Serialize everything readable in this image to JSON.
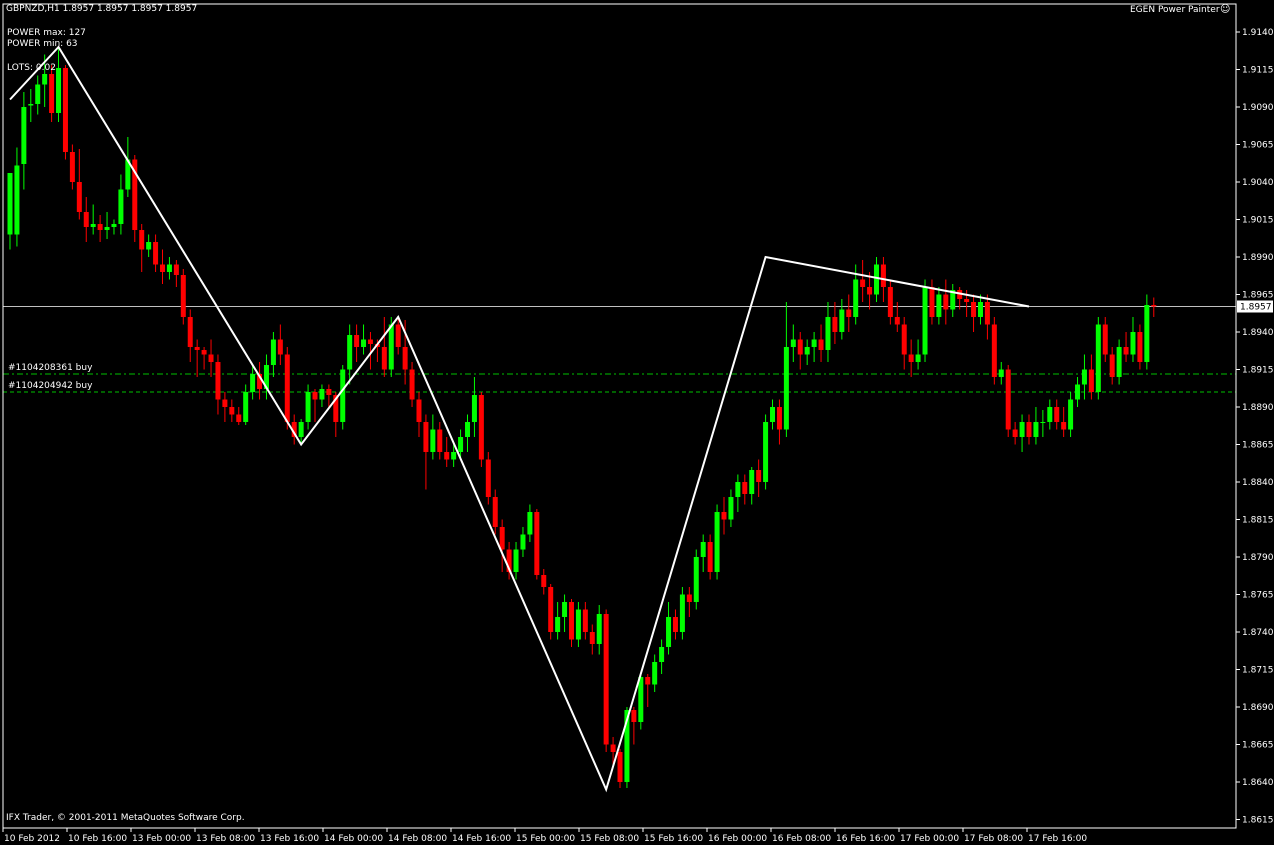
{
  "header": {
    "title": "GBPNZD,H1  1.8957 1.8957 1.8957 1.8957",
    "indicator_name": "EGEN Power Painter",
    "indicator_icon": "smiley-face-icon"
  },
  "info": {
    "power_max": "POWER max: 127",
    "power_min": "POWER min: 63",
    "lots": "LOTS: 0.02"
  },
  "orders": [
    {
      "label": "#1104208361 buy",
      "price": 1.8912
    },
    {
      "label": "#1104204942 buy",
      "price": 1.89
    }
  ],
  "footer": {
    "copyright": "IFX Trader, © 2001-2011 MetaQuotes Software Corp."
  },
  "colors": {
    "background": "#000000",
    "bull": "#00FF00",
    "bear": "#FF0000",
    "frame": "#FFFFFF",
    "order_line": "#00C000",
    "zigzag": "#FFFFFF"
  },
  "chart_data": {
    "type": "candlestick",
    "symbol": "GBPNZD",
    "timeframe": "H1",
    "current_price": 1.8957,
    "current_price_label": "1.8957",
    "y_ticks": [
      "1.9140",
      "1.9115",
      "1.9090",
      "1.9065",
      "1.9040",
      "1.9015",
      "1.8990",
      "1.8965",
      "1.8940",
      "1.8915",
      "1.8890",
      "1.8865",
      "1.8840",
      "1.8815",
      "1.8790",
      "1.8765",
      "1.8740",
      "1.8715",
      "1.8690",
      "1.8665",
      "1.8640",
      "1.8615"
    ],
    "ylim": [
      1.861,
      1.916
    ],
    "x_ticks": [
      "10 Feb 2012",
      "10 Feb 16:00",
      "13 Feb 00:00",
      "13 Feb 08:00",
      "13 Feb 16:00",
      "14 Feb 00:00",
      "14 Feb 08:00",
      "14 Feb 16:00",
      "15 Feb 00:00",
      "15 Feb 08:00",
      "15 Feb 16:00",
      "16 Feb 00:00",
      "16 Feb 08:00",
      "16 Feb 16:00",
      "17 Feb 00:00",
      "17 Feb 08:00",
      "17 Feb 16:00"
    ],
    "zigzag": [
      [
        0,
        1.9095
      ],
      [
        7,
        1.913
      ],
      [
        42,
        1.8865
      ],
      [
        56,
        1.895
      ],
      [
        86,
        1.8635
      ],
      [
        109,
        1.899
      ],
      [
        147,
        1.8957
      ]
    ],
    "candles": [
      [
        1.9005,
        1.9046,
        1.901,
        1.8995
      ],
      [
        1.9005,
        1.9051,
        1.8997,
        1.9063
      ],
      [
        1.9052,
        1.909,
        1.9035,
        1.91
      ],
      [
        1.9091,
        1.9092,
        1.908,
        1.9102
      ],
      [
        1.9092,
        1.9105,
        1.9085,
        1.9111
      ],
      [
        1.9105,
        1.9112,
        1.909,
        1.9125
      ],
      [
        1.9112,
        1.9086,
        1.908,
        1.9118
      ],
      [
        1.9086,
        1.9116,
        1.908,
        1.913
      ],
      [
        1.9116,
        1.906,
        1.9055,
        1.9118
      ],
      [
        1.906,
        1.904,
        1.9035,
        1.9065
      ],
      [
        1.904,
        1.902,
        1.9015,
        1.9062
      ],
      [
        1.902,
        1.901,
        1.9,
        1.903
      ],
      [
        1.901,
        1.9012,
        1.9005,
        1.9025
      ],
      [
        1.9012,
        1.9008,
        1.9,
        1.9018
      ],
      [
        1.9008,
        1.901,
        1.9002,
        1.902
      ],
      [
        1.901,
        1.9012,
        1.9005,
        1.9015
      ],
      [
        1.9012,
        1.9035,
        1.9005,
        1.9045
      ],
      [
        1.9035,
        1.9055,
        1.903,
        1.907
      ],
      [
        1.9055,
        1.9008,
        1.9,
        1.9058
      ],
      [
        1.9008,
        1.8995,
        1.898,
        1.9012
      ],
      [
        1.8995,
        1.9,
        1.899,
        1.9005
      ],
      [
        1.9,
        1.8985,
        1.898,
        1.9005
      ],
      [
        1.8985,
        1.898,
        1.8972,
        1.8995
      ],
      [
        1.898,
        1.8985,
        1.8975,
        1.899
      ],
      [
        1.8985,
        1.8978,
        1.897,
        1.8988
      ],
      [
        1.8978,
        1.895,
        1.8945,
        1.8982
      ],
      [
        1.895,
        1.893,
        1.892,
        1.8955
      ],
      [
        1.893,
        1.8928,
        1.891,
        1.8935
      ],
      [
        1.8928,
        1.8925,
        1.8915,
        1.893
      ],
      [
        1.8925,
        1.892,
        1.891,
        1.8935
      ],
      [
        1.892,
        1.8895,
        1.8885,
        1.8925
      ],
      [
        1.8895,
        1.889,
        1.888,
        1.89
      ],
      [
        1.889,
        1.8885,
        1.888,
        1.8895
      ],
      [
        1.8885,
        1.888,
        1.8878,
        1.889
      ],
      [
        1.888,
        1.89,
        1.8878,
        1.8905
      ],
      [
        1.89,
        1.8912,
        1.8895,
        1.8918
      ],
      [
        1.8912,
        1.8902,
        1.8895,
        1.892
      ],
      [
        1.8902,
        1.8918,
        1.8895,
        1.8925
      ],
      [
        1.8918,
        1.8935,
        1.891,
        1.894
      ],
      [
        1.8935,
        1.8925,
        1.8918,
        1.8945
      ],
      [
        1.8925,
        1.888,
        1.8875,
        1.893
      ],
      [
        1.888,
        1.887,
        1.8865,
        1.8885
      ],
      [
        1.887,
        1.888,
        1.8865,
        1.8882
      ],
      [
        1.888,
        1.89,
        1.8875,
        1.8905
      ],
      [
        1.89,
        1.8895,
        1.888,
        1.8902
      ],
      [
        1.8895,
        1.8902,
        1.889,
        1.8905
      ],
      [
        1.8902,
        1.8898,
        1.889,
        1.8905
      ],
      [
        1.8898,
        1.888,
        1.887,
        1.89
      ],
      [
        1.888,
        1.8915,
        1.8875,
        1.8918
      ],
      [
        1.8915,
        1.8938,
        1.8905,
        1.8945
      ],
      [
        1.8938,
        1.893,
        1.892,
        1.8945
      ],
      [
        1.893,
        1.8935,
        1.8925,
        1.8945
      ],
      [
        1.8935,
        1.8932,
        1.8915,
        1.894
      ],
      [
        1.8932,
        1.893,
        1.892,
        1.8935
      ],
      [
        1.893,
        1.8915,
        1.891,
        1.895
      ],
      [
        1.8915,
        1.8945,
        1.891,
        1.895
      ],
      [
        1.8945,
        1.893,
        1.8925,
        1.895
      ],
      [
        1.893,
        1.8915,
        1.8905,
        1.8948
      ],
      [
        1.8915,
        1.8895,
        1.889,
        1.892
      ],
      [
        1.8895,
        1.888,
        1.887,
        1.89
      ],
      [
        1.888,
        1.886,
        1.8835,
        1.8885
      ],
      [
        1.886,
        1.8875,
        1.8855,
        1.8885
      ],
      [
        1.8875,
        1.886,
        1.8855,
        1.888
      ],
      [
        1.886,
        1.8855,
        1.885,
        1.887
      ],
      [
        1.8855,
        1.886,
        1.885,
        1.8865
      ],
      [
        1.886,
        1.887,
        1.8855,
        1.8875
      ],
      [
        1.887,
        1.888,
        1.886,
        1.8885
      ],
      [
        1.888,
        1.8898,
        1.887,
        1.891
      ],
      [
        1.8898,
        1.8855,
        1.885,
        1.89
      ],
      [
        1.8855,
        1.883,
        1.8825,
        1.886
      ],
      [
        1.883,
        1.881,
        1.8805,
        1.8835
      ],
      [
        1.881,
        1.8795,
        1.878,
        1.8815
      ],
      [
        1.8795,
        1.878,
        1.8775,
        1.88
      ],
      [
        1.878,
        1.8795,
        1.8775,
        1.88
      ],
      [
        1.8795,
        1.8805,
        1.879,
        1.881
      ],
      [
        1.8805,
        1.882,
        1.88,
        1.8825
      ],
      [
        1.882,
        1.8778,
        1.8775,
        1.8822
      ],
      [
        1.8778,
        1.877,
        1.8765,
        1.8782
      ],
      [
        1.877,
        1.874,
        1.8735,
        1.8772
      ],
      [
        1.874,
        1.875,
        1.8735,
        1.876
      ],
      [
        1.875,
        1.876,
        1.874,
        1.8765
      ],
      [
        1.876,
        1.8735,
        1.873,
        1.8762
      ],
      [
        1.8735,
        1.8755,
        1.873,
        1.876
      ],
      [
        1.8755,
        1.874,
        1.8735,
        1.876
      ],
      [
        1.874,
        1.8732,
        1.8725,
        1.8745
      ],
      [
        1.8732,
        1.8752,
        1.8725,
        1.8758
      ],
      [
        1.8752,
        1.8665,
        1.866,
        1.8755
      ],
      [
        1.8665,
        1.866,
        1.865,
        1.867
      ],
      [
        1.866,
        1.864,
        1.8636,
        1.8662
      ],
      [
        1.864,
        1.8688,
        1.8636,
        1.869
      ],
      [
        1.8688,
        1.868,
        1.8665,
        1.869
      ],
      [
        1.868,
        1.871,
        1.8675,
        1.8712
      ],
      [
        1.871,
        1.8705,
        1.869,
        1.8712
      ],
      [
        1.8705,
        1.872,
        1.87,
        1.8725
      ],
      [
        1.872,
        1.873,
        1.8712,
        1.8735
      ],
      [
        1.873,
        1.875,
        1.8725,
        1.876
      ],
      [
        1.875,
        1.874,
        1.8735,
        1.8755
      ],
      [
        1.874,
        1.8765,
        1.8735,
        1.877
      ],
      [
        1.8765,
        1.876,
        1.875,
        1.877
      ],
      [
        1.876,
        1.879,
        1.8755,
        1.8795
      ],
      [
        1.879,
        1.88,
        1.878,
        1.8805
      ],
      [
        1.88,
        1.878,
        1.8775,
        1.8805
      ],
      [
        1.878,
        1.882,
        1.8775,
        1.8825
      ],
      [
        1.882,
        1.8815,
        1.8805,
        1.883
      ],
      [
        1.8815,
        1.883,
        1.881,
        1.8835
      ],
      [
        1.883,
        1.884,
        1.882,
        1.8845
      ],
      [
        1.884,
        1.8832,
        1.8825,
        1.8845
      ],
      [
        1.8832,
        1.8848,
        1.8825,
        1.885
      ],
      [
        1.8848,
        1.884,
        1.883,
        1.8855
      ],
      [
        1.884,
        1.888,
        1.8835,
        1.8885
      ],
      [
        1.888,
        1.889,
        1.8875,
        1.8895
      ],
      [
        1.889,
        1.8875,
        1.8865,
        1.8895
      ],
      [
        1.8875,
        1.893,
        1.887,
        1.896
      ],
      [
        1.893,
        1.8935,
        1.892,
        1.8945
      ],
      [
        1.8935,
        1.8925,
        1.8915,
        1.894
      ],
      [
        1.8925,
        1.893,
        1.8918,
        1.8935
      ],
      [
        1.893,
        1.8935,
        1.892,
        1.894
      ],
      [
        1.8935,
        1.8928,
        1.892,
        1.8945
      ],
      [
        1.8928,
        1.895,
        1.892,
        1.896
      ],
      [
        1.895,
        1.894,
        1.8932,
        1.896
      ],
      [
        1.894,
        1.8955,
        1.8935,
        1.8962
      ],
      [
        1.8955,
        1.895,
        1.894,
        1.8965
      ],
      [
        1.895,
        1.8975,
        1.8945,
        1.8985
      ],
      [
        1.8975,
        1.897,
        1.896,
        1.8988
      ],
      [
        1.897,
        1.8965,
        1.8955,
        1.898
      ],
      [
        1.8965,
        1.8985,
        1.896,
        1.899
      ],
      [
        1.8985,
        1.897,
        1.896,
        1.899
      ],
      [
        1.897,
        1.895,
        1.8945,
        1.8975
      ],
      [
        1.895,
        1.8945,
        1.894,
        1.896
      ],
      [
        1.8945,
        1.8925,
        1.8915,
        1.895
      ],
      [
        1.8925,
        1.892,
        1.891,
        1.8935
      ],
      [
        1.892,
        1.8925,
        1.8915,
        1.8935
      ],
      [
        1.8925,
        1.897,
        1.892,
        1.8975
      ],
      [
        1.897,
        1.895,
        1.8945,
        1.8975
      ],
      [
        1.895,
        1.8965,
        1.8945,
        1.897
      ],
      [
        1.8965,
        1.8955,
        1.8945,
        1.8975
      ],
      [
        1.8955,
        1.8968,
        1.895,
        1.8972
      ],
      [
        1.8968,
        1.8962,
        1.8955,
        1.897
      ],
      [
        1.8962,
        1.896,
        1.895,
        1.8968
      ],
      [
        1.896,
        1.895,
        1.894,
        1.8965
      ],
      [
        1.895,
        1.896,
        1.8945,
        1.8965
      ],
      [
        1.896,
        1.8945,
        1.8935,
        1.8965
      ],
      [
        1.8945,
        1.891,
        1.8905,
        1.895
      ],
      [
        1.891,
        1.8915,
        1.8905,
        1.892
      ],
      [
        1.8915,
        1.8875,
        1.887,
        1.8918
      ],
      [
        1.8875,
        1.887,
        1.8865,
        1.888
      ],
      [
        1.887,
        1.888,
        1.886,
        1.8885
      ],
      [
        1.888,
        1.887,
        1.8865,
        1.8885
      ],
      [
        1.887,
        1.888,
        1.8865,
        1.889
      ],
      [
        1.888,
        1.888,
        1.887,
        1.8888
      ],
      [
        1.888,
        1.889,
        1.8875,
        1.8895
      ],
      [
        1.889,
        1.888,
        1.8875,
        1.8895
      ],
      [
        1.888,
        1.8875,
        1.887,
        1.889
      ],
      [
        1.8875,
        1.8895,
        1.887,
        1.89
      ],
      [
        1.8895,
        1.8905,
        1.889,
        1.891
      ],
      [
        1.8905,
        1.8915,
        1.8895,
        1.8925
      ],
      [
        1.8915,
        1.89,
        1.8895,
        1.8925
      ],
      [
        1.89,
        1.8945,
        1.8895,
        1.895
      ],
      [
        1.8945,
        1.8925,
        1.892,
        1.895
      ],
      [
        1.8925,
        1.891,
        1.8905,
        1.893
      ],
      [
        1.891,
        1.893,
        1.8905,
        1.8935
      ],
      [
        1.893,
        1.8925,
        1.892,
        1.894
      ],
      [
        1.8925,
        1.894,
        1.892,
        1.895
      ],
      [
        1.894,
        1.892,
        1.8915,
        1.8945
      ],
      [
        1.892,
        1.8958,
        1.8915,
        1.8965
      ],
      [
        1.8958,
        1.8957,
        1.895,
        1.8963
      ]
    ]
  }
}
